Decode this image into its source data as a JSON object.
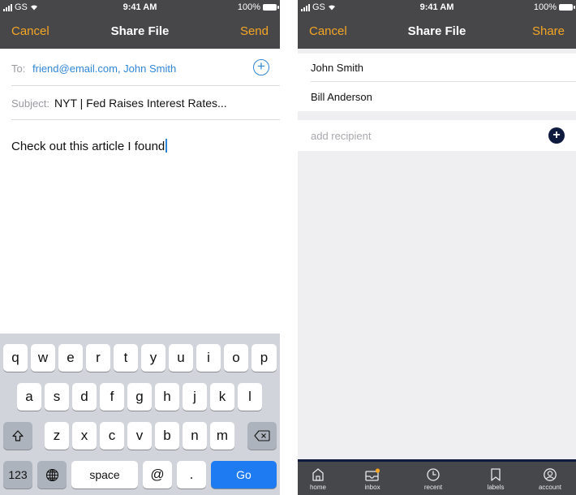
{
  "status_bar": {
    "carrier": "GS",
    "time": "9:41 AM",
    "battery": "100%"
  },
  "left": {
    "nav": {
      "cancel": "Cancel",
      "title": "Share File",
      "action": "Send"
    },
    "to_label": "To:",
    "to_value": "friend@email.com, John Smith",
    "subject_label": "Subject:",
    "subject_value": "NYT | Fed Raises Interest Rates...",
    "body": "Check out this article I found",
    "keyboard": {
      "row1": [
        "q",
        "w",
        "e",
        "r",
        "t",
        "y",
        "u",
        "i",
        "o",
        "p"
      ],
      "row2": [
        "a",
        "s",
        "d",
        "f",
        "g",
        "h",
        "j",
        "k",
        "l"
      ],
      "row3": [
        "z",
        "x",
        "c",
        "v",
        "b",
        "n",
        "m"
      ],
      "numbers_key": "123",
      "space_key": "space",
      "at_key": "@",
      "dot_key": ".",
      "go_key": "Go"
    }
  },
  "right": {
    "nav": {
      "cancel": "Cancel",
      "title": "Share File",
      "action": "Share"
    },
    "recipients": [
      "John Smith",
      "Bill Anderson"
    ],
    "add_placeholder": "add recipient",
    "tabs": [
      {
        "label": "home",
        "icon": "home-icon"
      },
      {
        "label": "inbox",
        "icon": "inbox-icon"
      },
      {
        "label": "recent",
        "icon": "clock-icon"
      },
      {
        "label": "labels",
        "icon": "bookmark-icon"
      },
      {
        "label": "account",
        "icon": "account-icon"
      }
    ]
  },
  "colors": {
    "nav_bg": "#47474a",
    "accent": "#f5a623",
    "link": "#2f86d8",
    "go": "#1e7bf2",
    "navy": "#0e1b3f"
  }
}
